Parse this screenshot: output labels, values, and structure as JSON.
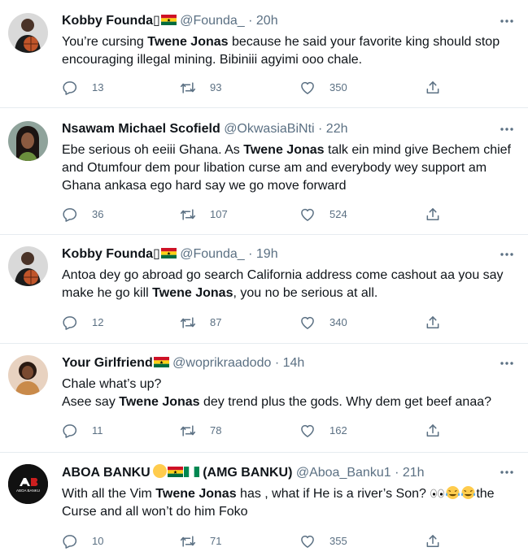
{
  "tweets": [
    {
      "name": "Kobby Founda▯",
      "handle": "@Founda_",
      "sep": "·",
      "time": "20h",
      "text_parts": [
        "You’re cursing ",
        "Twene Jonas",
        " because he said your favorite king should stop encouraging illegal mining. Bibiniii agyimi ooo chale."
      ],
      "replies": "13",
      "retweets": "93",
      "likes": "350"
    },
    {
      "name": "Nsawam Michael Scofield",
      "handle": "@OkwasiaBiNti",
      "sep": "·",
      "time": "22h",
      "text_parts": [
        "Ebe serious oh eeiii Ghana. As ",
        "Twene Jonas",
        " talk ein mind give Bechem chief and Otumfour dem pour libation curse am and everybody wey support am Ghana ankasa ego hard say we go move forward"
      ],
      "replies": "36",
      "retweets": "107",
      "likes": "524"
    },
    {
      "name": "Kobby Founda▯",
      "handle": "@Founda_",
      "sep": "·",
      "time": "19h",
      "text_parts": [
        "Antoa dey go abroad go search California address come cashout aa you say make he go kill ",
        "Twene Jonas",
        ", you no be serious at all."
      ],
      "replies": "12",
      "retweets": "87",
      "likes": "340"
    },
    {
      "name": "Your Girlfriend",
      "handle": "@woprikraadodo",
      "sep": "·",
      "time": "14h",
      "text_line1": "Chale what’s up?",
      "text_parts": [
        "Asee say ",
        "Twene Jonas",
        " dey trend plus the gods. Why dem get beef anaa?"
      ],
      "replies": "11",
      "retweets": "78",
      "likes": "162"
    },
    {
      "name_a": "ABOA BANKU",
      "name_b": "(AMG BANKU)",
      "handle": "@Aboa_Banku1",
      "sep": "·",
      "time": "21h",
      "avatar_text": "ABOA BANKU",
      "text_parts": [
        "With all the Vim ",
        "Twene Jonas",
        " has , what if He is a river’s Son? ",
        "the Curse and all won’t do him Foko"
      ],
      "replies": "10",
      "retweets": "71",
      "likes": "355"
    }
  ],
  "colors": {
    "text": "#0f1419",
    "muted": "#5b7083",
    "divider": "#e6ecf0",
    "ghana_red": "#ce1126",
    "ghana_gold": "#fcd116",
    "ghana_green": "#006b3f",
    "nigeria_green": "#008751"
  },
  "icons": [
    "reply-icon",
    "retweet-icon",
    "like-icon",
    "share-icon",
    "more-icon",
    "ghana-flag-icon",
    "nigeria-flag-icon"
  ]
}
